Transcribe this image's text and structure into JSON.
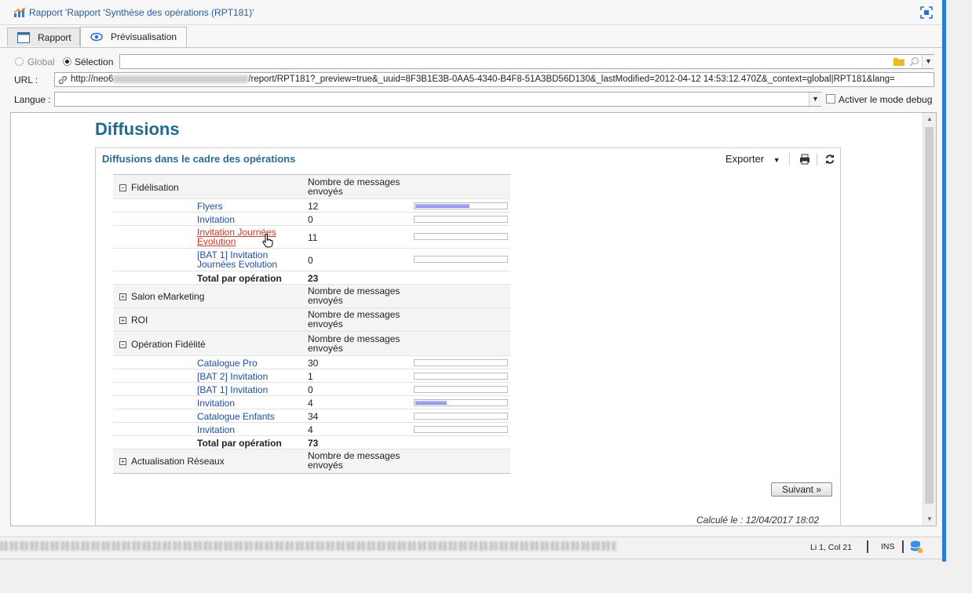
{
  "window": {
    "title": "Rapport 'Rapport 'Synthèse des opérations (RPT181)'"
  },
  "tabs": [
    {
      "label": "Rapport"
    },
    {
      "label": "Prévisualisation"
    }
  ],
  "scope": {
    "global_label": "Global",
    "selection_label": "Sélection",
    "selected": "Sélection"
  },
  "url": {
    "label": "URL :",
    "prefix": "http://neo6",
    "value": "/report/RPT181?_preview=true&_uuid=8F3B1E3B-0AA5-4340-B4F8-51A3BD56D130&_lastModified=2012-04-12 14:53:12.470Z&_context=global|RPT181&lang="
  },
  "langue": {
    "label": "Langue :",
    "value": "",
    "debug_label": "Activer le mode debug",
    "debug_checked": false
  },
  "report": {
    "heading": "Diffusions",
    "panel_title": "Diffusions dans le cadre des opérations",
    "export_label": "Exporter",
    "next_button": "Suivant »",
    "computed": "Calculé le : 12/04/2017 18:02",
    "col_label_line1": "Nombre de messages",
    "col_label_line2": "envoyés",
    "total_label": "Total par opération",
    "groups": [
      {
        "name": "Fidélisation",
        "expanded": true,
        "rows": [
          {
            "label": "Flyers",
            "value": "12",
            "bar": 0.6
          },
          {
            "label": "Invitation",
            "value": "0",
            "bar": 0
          },
          {
            "label_line1": "Invitation Journées",
            "label_line2": "Evolution",
            "value": "11",
            "bar": 0
          },
          {
            "label_line1": "[BAT 1] Invitation",
            "label_line2": "Journées Evolution",
            "value": "0",
            "bar": 0
          }
        ],
        "total": "23"
      },
      {
        "name": "Salon eMarketing",
        "expanded": false
      },
      {
        "name": "ROI",
        "expanded": false
      },
      {
        "name": "Opération Fidélité",
        "expanded": true,
        "rows": [
          {
            "label": "Catalogue Pro",
            "value": "30",
            "bar": 0
          },
          {
            "label": "[BAT 2] Invitation",
            "value": "1",
            "bar": 0
          },
          {
            "label": "[BAT 1] Invitation",
            "value": "0",
            "bar": 0
          },
          {
            "label": "Invitation",
            "value": "4",
            "bar": 0.35
          },
          {
            "label": "Catalogue Enfants",
            "value": "34",
            "bar": 0
          },
          {
            "label": "Invitation",
            "value": "4",
            "bar": 0
          }
        ],
        "total": "73"
      },
      {
        "name": "Actualisation Réseaux",
        "expanded": false
      }
    ]
  },
  "statusbar": {
    "position": "Li 1, Col 21",
    "mode": "INS"
  },
  "colors": {
    "title_blue": "#2a5a9a",
    "heading_teal": "#1f6b8f",
    "link_blue": "#1f4fa0",
    "hover_link": "#c0392b",
    "bar_fill": "#9a9af0"
  }
}
